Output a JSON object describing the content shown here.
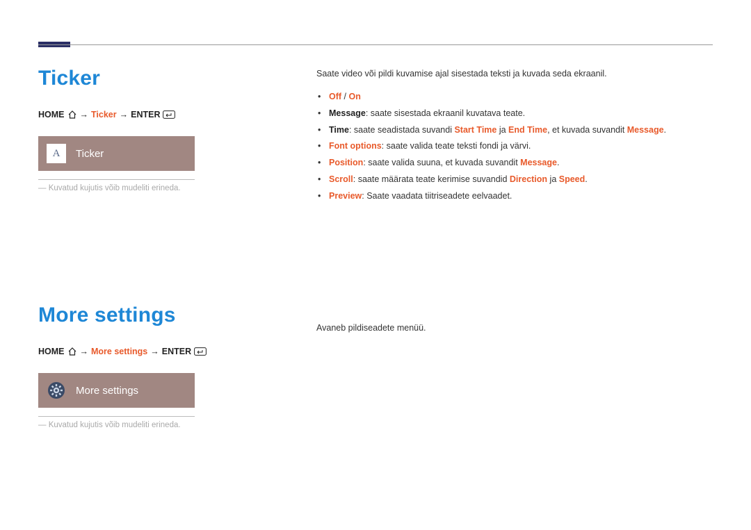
{
  "ticker": {
    "heading": "Ticker",
    "breadcrumb": {
      "home": "HOME",
      "item": "Ticker",
      "enter": "ENTER"
    },
    "tile_letter": "A",
    "tile_label": "Ticker",
    "note": "Kuvatud kujutis võib mudeliti erineda.",
    "intro": "Saate video või pildi kuvamise ajal sisestada teksti ja kuvada seda ekraanil.",
    "bullets": {
      "b1_off": "Off",
      "b1_sep": " / ",
      "b1_on": "On",
      "b2_label": "Message",
      "b2_text": ": saate sisestada ekraanil kuvatava teate.",
      "b3_label": "Time",
      "b3_t1": ": saate seadistada suvandi ",
      "b3_start": "Start Time",
      "b3_ja1": " ja ",
      "b3_end": "End Time",
      "b3_t2": ", et kuvada suvandit ",
      "b3_msg": "Message",
      "b3_dot": ".",
      "b4_label": "Font options",
      "b4_text": ": saate valida teate teksti fondi ja värvi.",
      "b5_label": "Position",
      "b5_t1": ": saate valida suuna, et kuvada suvandit ",
      "b5_msg": "Message",
      "b5_dot": ".",
      "b6_label": "Scroll",
      "b6_t1": ": saate määrata teate kerimise suvandid ",
      "b6_dir": "Direction",
      "b6_ja": " ja ",
      "b6_speed": "Speed",
      "b6_dot": ".",
      "b7_label": "Preview",
      "b7_text": ": Saate vaadata tiitriseadete eelvaadet."
    }
  },
  "more": {
    "heading": "More settings",
    "breadcrumb": {
      "home": "HOME",
      "item": "More settings",
      "enter": "ENTER"
    },
    "tile_label": "More settings",
    "note": "Kuvatud kujutis võib mudeliti erineda.",
    "intro": "Avaneb pildiseadete menüü."
  }
}
